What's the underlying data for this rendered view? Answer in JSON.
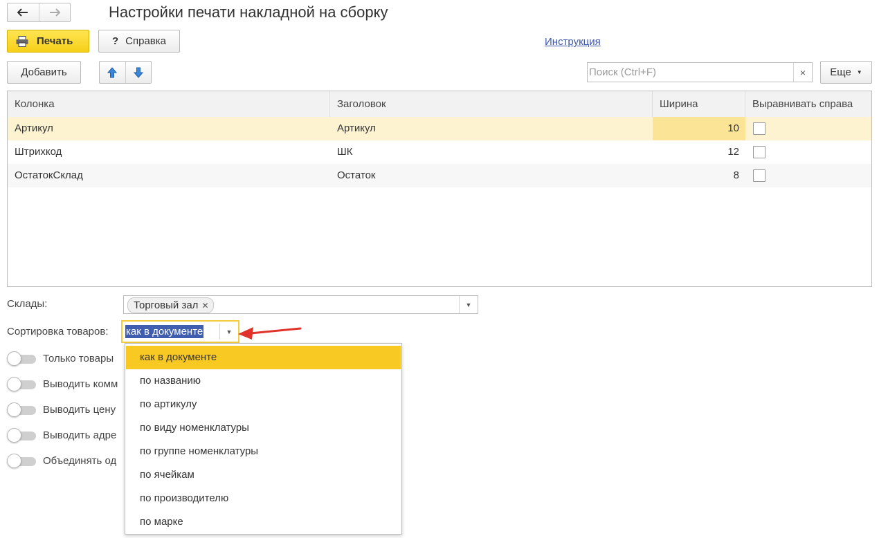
{
  "window": {
    "title": "Настройки печати накладной на сборку"
  },
  "nav": {
    "back_icon": "arrow-left-icon",
    "forward_icon": "arrow-right-icon"
  },
  "toolbar": {
    "print_label": "Печать",
    "help_label": "Справка",
    "help_glyph": "?",
    "instruction_link": "Инструкция"
  },
  "commandbar": {
    "add_label": "Добавить",
    "more_label": "Еще",
    "search_placeholder": "Поиск (Ctrl+F)",
    "clear_glyph": "×"
  },
  "table": {
    "headers": [
      "Колонка",
      "Заголовок",
      "Ширина",
      "Выравнивать справа"
    ],
    "rows": [
      {
        "column": "Артикул",
        "header": "Артикул",
        "width": "10",
        "align_right": false
      },
      {
        "column": "Штрихкод",
        "header": "ШК",
        "width": "12",
        "align_right": false
      },
      {
        "column": "ОстатокСклад",
        "header": "Остаток",
        "width": "8",
        "align_right": false
      }
    ]
  },
  "form": {
    "warehouses_label": "Склады:",
    "warehouse_tag": "Торговый зал",
    "tag_remove_glyph": "✕",
    "sort_label": "Сортировка товаров:",
    "sort_value": "как в документе",
    "toggles": [
      {
        "label": "Только товары",
        "on": false
      },
      {
        "label": "Выводить комм",
        "on": false
      },
      {
        "label": "Выводить цену",
        "on": false
      },
      {
        "label": "Выводить адре",
        "on": false
      },
      {
        "label": "Объединять од",
        "on": false
      }
    ]
  },
  "sort_dropdown": {
    "options": [
      "как в документе",
      "по названию",
      "по артикулу",
      "по виду номенклатуры",
      "по группе номенклатуры",
      "по ячейкам",
      "по производителю",
      "по марке"
    ],
    "selected_index": 0
  },
  "colors": {
    "accent_yellow": "#f8c923",
    "row_highlight": "#fdf3d0",
    "selected_cell": "#fce497",
    "link_blue": "#3c57b0",
    "arrow_red": "#e0332b",
    "updown_blue": "#3a86d8"
  }
}
